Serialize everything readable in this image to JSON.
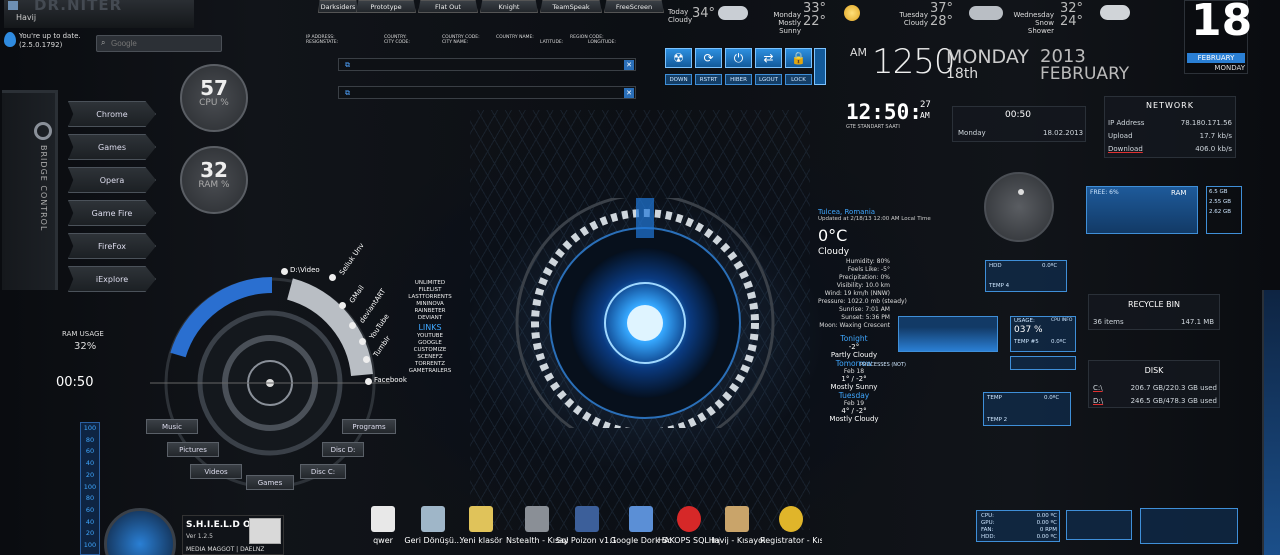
{
  "brand": {
    "logo_text": "DR.NITER",
    "user": "Havij"
  },
  "update": {
    "line1": "You're up to date.",
    "line2": "(2.5.0.1792)"
  },
  "search": {
    "placeholder": "Google"
  },
  "top_tabs": [
    "Darksiders",
    "Prototype",
    "Flat Out",
    "Knight",
    "TeamSpeak",
    "FreeScreen"
  ],
  "weather_strip": [
    {
      "day": "Today",
      "cond": "Cloudy",
      "temp": "34°"
    },
    {
      "day": "Monday",
      "cond": "Mostly Sunny",
      "temp": "33° 22°"
    },
    {
      "day": "Tuesday",
      "cond": "Cloudy",
      "temp": "37° 28°"
    },
    {
      "day": "Wednesday",
      "cond": "Snow Shower",
      "temp": "32° 24°"
    }
  ],
  "calendar": {
    "day_num": "18",
    "month": "FEBRUARY",
    "weekday": "MONDAY"
  },
  "launcher": {
    "title": "BRIDGE CONTROL",
    "items": [
      "Chrome",
      "Games",
      "Opera",
      "Game Fire",
      "FireFox",
      "iExplore"
    ]
  },
  "cpu": {
    "value": "57",
    "label": "CPU %"
  },
  "ram": {
    "value": "32",
    "label": "RAM %"
  },
  "netinfo": {
    "headers": [
      "IP ADDRESS:",
      "RESIGNSTATE:",
      "COUNTRY:",
      "CITY CODE:",
      "COUNTRY CODE:",
      "CITY NAME:",
      "COUNTRY NAME:",
      "LATITUDE:",
      "REGION CODE:",
      "LONGITUDE:"
    ]
  },
  "power": {
    "labels": [
      "DOWN",
      "RSTRT",
      "HIBER",
      "LGOUT",
      "LOCK"
    ]
  },
  "clock_big": {
    "am": "AM",
    "time": "1250",
    "day": "MONDAY",
    "date": "18th",
    "year": "2013",
    "month": "FEBRUARY"
  },
  "clock_digital": {
    "time": "12:50:",
    "sec": "27",
    "ampm": "AM",
    "zone": "GTE STANDART SAATI"
  },
  "mini_clock": {
    "time": "00:50",
    "day": "Monday",
    "date": "18.02.2013"
  },
  "network": {
    "title": "NETWORK",
    "rows": [
      {
        "label": "IP Address",
        "value": "78.180.171.56"
      },
      {
        "label": "Upload",
        "value": "17.7 kb/s"
      },
      {
        "label": "Download",
        "value": "406.0 kb/s"
      }
    ]
  },
  "ram_box": {
    "free": "FREE: 6%",
    "title": "RAM",
    "vals": [
      "6.5 GB",
      "2.55 GB",
      "2.62 GB"
    ]
  },
  "recycle": {
    "title": "RECYCLE BIN",
    "items": "36 items",
    "size": "147.1 MB"
  },
  "disk": {
    "title": "DISK",
    "rows": [
      {
        "drive": "C:\\",
        "usage": "206.7 GB/220.3 GB used"
      },
      {
        "drive": "D:\\",
        "usage": "246.5 GB/478.3 GB used"
      }
    ]
  },
  "weather_detail": {
    "location": "Tulcea, Romania",
    "updated": "Updated at 2/18/13 12:00 AM Local Time",
    "temp": "0°C",
    "cond": "Cloudy",
    "lines": [
      "Humidity: 80%",
      "Feels Like: -5°",
      "Precipitation: 0%",
      "Visibility: 10.0 km",
      "Wind: 19 km/h (NNW)",
      "Pressure: 1022.0 mb (steady)",
      "Sunrise: 7:01 AM",
      "Sunset: 5:36 PM",
      "Moon: Waxing Crescent"
    ],
    "forecast": [
      {
        "title": "Tonight",
        "date": "",
        "temp": "-2°",
        "cond": "Partly Cloudy"
      },
      {
        "title": "Tomorrow",
        "date": "Feb 18",
        "temp": "1° / -2°",
        "cond": "Mostly Sunny"
      },
      {
        "title": "Tuesday",
        "date": "Feb 19",
        "temp": "4° / -2°",
        "cond": "Mostly Cloudy"
      }
    ]
  },
  "hdd_box": {
    "hdd": "HDD",
    "temp": "0.0ºC",
    "label": "TEMP 4"
  },
  "usage_box": {
    "usage": "USAGE:",
    "pct": "037 %",
    "cpu_info": "CPU INFO",
    "temp": "TEMP #5",
    "temp_val": "0.0ºC",
    "proc": "PROCESSES (NOT)"
  },
  "temp2": {
    "label": "TEMP",
    "val": "0.0ºC",
    "sub": "TEMP 2"
  },
  "sensors": {
    "rows": [
      {
        "l": "CPU:",
        "v": "0.00 ºC"
      },
      {
        "l": "GPU:",
        "v": "0.00 ºC"
      },
      {
        "l": "FAN:",
        "v": "0 RPM"
      },
      {
        "l": "HDD:",
        "v": "0.00 ºC"
      }
    ]
  },
  "ring_menu": {
    "time": "00:50",
    "ram_label": "RAM USAGE",
    "ram_pct": "32%",
    "links": [
      "D:\\Video",
      "Seiluk Unv",
      "GMail",
      "deviantART",
      "YouTube",
      "Tumblr",
      "Facebook"
    ],
    "folders": [
      "Music",
      "Pictures",
      "Videos",
      "Games",
      "Disc C:",
      "Disc D:",
      "Programs"
    ]
  },
  "link_list": {
    "items": [
      "UNLIMITED",
      "FILELIST",
      "LASTTORRENTS",
      "MININOVA",
      "RAINBETER",
      "DEVIANT"
    ],
    "title": "LINKS",
    "items2": [
      "YOUTUBE",
      "GOOGLE",
      "CUSTOMIZE",
      "SCENEFZ",
      "TORRENTZ",
      "GAMETRAILERS"
    ]
  },
  "gauge_numbers": [
    "100",
    "80",
    "60",
    "40",
    "20",
    "100",
    "80",
    "60",
    "40",
    "20",
    "100"
  ],
  "shield": {
    "title": "S.H.I.E.L.D OS",
    "ver": "Ver 1.2.5",
    "footer": "MEDIA MAGGOT | DAELNZ"
  },
  "desktop_icons": [
    {
      "label": "qwer",
      "color": "#e8e8e8"
    },
    {
      "label": "Geri Dönüşü...",
      "color": "#9fb6c8"
    },
    {
      "label": "Yeni klasör",
      "color": "#e0c35a"
    },
    {
      "label": "Nstealth - Kısayol",
      "color": "#8a8f96"
    },
    {
      "label": "Sql Poizon v1.1 - Th...",
      "color": "#3c5f9a"
    },
    {
      "label": "Google Dork Scanner v2...",
      "color": "#5b8fd6"
    },
    {
      "label": "HAKOPS SQL Inj. Arama...",
      "color": "#d62828"
    },
    {
      "label": "Havij - Kısayol",
      "color": "#c9a46a"
    },
    {
      "label": "Registrator - Kısayol",
      "color": "#e0b52a"
    }
  ]
}
